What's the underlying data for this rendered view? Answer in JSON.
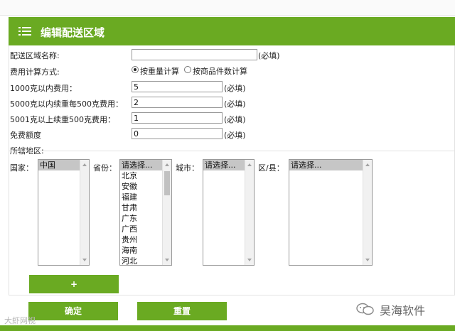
{
  "header": {
    "title": "编辑配送区域",
    "icon": "list-icon"
  },
  "form": {
    "area_name": {
      "label": "配送区域名称:",
      "value": "",
      "required": "(必填)"
    },
    "fee_method": {
      "label": "费用计算方式:",
      "options": [
        "按重量计算",
        "按商品件数计算"
      ],
      "selected": "按重量计算"
    },
    "fee_1000g": {
      "label": "1000克以内费用：",
      "value": "5",
      "required": "(必填)"
    },
    "fee_5000g": {
      "label": "5000克以内续重每500克费用：",
      "value": "2",
      "required": "(必填)"
    },
    "fee_5001g": {
      "label": "5001克以上续重500克费用：",
      "value": "1",
      "required": "(必填)"
    },
    "free_quota": {
      "label": "免费额度",
      "value": "0",
      "required": "(必填)"
    }
  },
  "region": {
    "title": "所辖地区:",
    "country": {
      "label": "国家：",
      "options": [
        "中国"
      ],
      "selected": "中国"
    },
    "province": {
      "label": "省份：",
      "options": [
        "请选择...",
        "北京",
        "安徽",
        "福建",
        "甘肃",
        "广东",
        "广西",
        "贵州",
        "海南",
        "河北"
      ],
      "selected": "请选择..."
    },
    "city": {
      "label": "城市：",
      "options": [
        "请选择..."
      ],
      "selected": "请选择..."
    },
    "county": {
      "label": "区/县：",
      "options": [
        "请选择..."
      ],
      "selected": "请选择..."
    },
    "add_label": "+"
  },
  "actions": {
    "confirm_label": "确定",
    "reset_label": "重置"
  },
  "watermark": "大虾网视",
  "brand": {
    "name": "昊海软件",
    "icon": "wechat-icon"
  },
  "colors": {
    "accent": "#6aaa22",
    "selected_option": "#c6c6c6"
  }
}
